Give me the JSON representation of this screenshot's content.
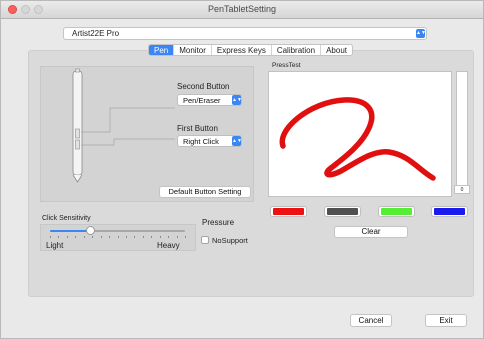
{
  "window": {
    "title": "PenTabletSetting"
  },
  "device": {
    "selected": "Artist22E Pro"
  },
  "tabs": [
    {
      "label": "Pen",
      "active": true
    },
    {
      "label": "Monitor",
      "active": false
    },
    {
      "label": "Express Keys",
      "active": false
    },
    {
      "label": "Calibration",
      "active": false
    },
    {
      "label": "About",
      "active": false
    }
  ],
  "pen": {
    "second_button_label": "Second Button",
    "second_button_value": "Pen/Eraser",
    "first_button_label": "First Button",
    "first_button_value": "Right Click",
    "default_button_label": "Default  Button Setting"
  },
  "press_test": {
    "label": "PressTest",
    "level_value": "0",
    "stroke_color": "#e01010",
    "colors": [
      "#ee1111",
      "#505050",
      "#55ee33",
      "#1a1aee"
    ],
    "clear_label": "Clear"
  },
  "sensitivity": {
    "label": "Click Sensitivity",
    "min_label": "Light",
    "max_label": "Heavy",
    "value_fraction": 0.3
  },
  "pressure": {
    "label": "Pressure",
    "checkbox_label": "NoSupport",
    "checked": false
  },
  "footer": {
    "cancel_label": "Cancel",
    "exit_label": "Exit"
  },
  "accent_color": "#3a86f5"
}
